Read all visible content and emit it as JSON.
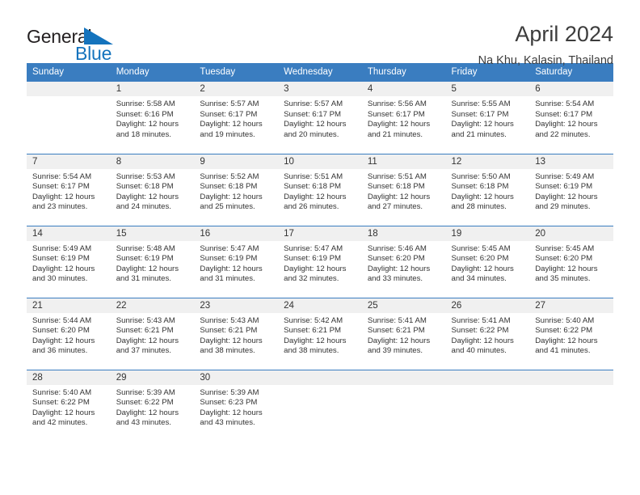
{
  "brand": {
    "word_one": "General",
    "word_two": "Blue",
    "flag_icon": "triangle-flag-icon",
    "accent_color": "#1473bd"
  },
  "header": {
    "title": "April 2024",
    "subtitle": "Na Khu, Kalasin, Thailand"
  },
  "theme": {
    "header_blue": "#3a7dc0",
    "band_gray": "#f0f0f0",
    "text": "#333333"
  },
  "calendar": {
    "weekday_headers": [
      "Sunday",
      "Monday",
      "Tuesday",
      "Wednesday",
      "Thursday",
      "Friday",
      "Saturday"
    ],
    "weeks": [
      [
        {
          "day": "",
          "sunrise": "",
          "sunset": "",
          "daylight_line1": "",
          "daylight_line2": ""
        },
        {
          "day": "1",
          "sunrise": "Sunrise: 5:58 AM",
          "sunset": "Sunset: 6:16 PM",
          "daylight_line1": "Daylight: 12 hours",
          "daylight_line2": "and 18 minutes."
        },
        {
          "day": "2",
          "sunrise": "Sunrise: 5:57 AM",
          "sunset": "Sunset: 6:17 PM",
          "daylight_line1": "Daylight: 12 hours",
          "daylight_line2": "and 19 minutes."
        },
        {
          "day": "3",
          "sunrise": "Sunrise: 5:57 AM",
          "sunset": "Sunset: 6:17 PM",
          "daylight_line1": "Daylight: 12 hours",
          "daylight_line2": "and 20 minutes."
        },
        {
          "day": "4",
          "sunrise": "Sunrise: 5:56 AM",
          "sunset": "Sunset: 6:17 PM",
          "daylight_line1": "Daylight: 12 hours",
          "daylight_line2": "and 21 minutes."
        },
        {
          "day": "5",
          "sunrise": "Sunrise: 5:55 AM",
          "sunset": "Sunset: 6:17 PM",
          "daylight_line1": "Daylight: 12 hours",
          "daylight_line2": "and 21 minutes."
        },
        {
          "day": "6",
          "sunrise": "Sunrise: 5:54 AM",
          "sunset": "Sunset: 6:17 PM",
          "daylight_line1": "Daylight: 12 hours",
          "daylight_line2": "and 22 minutes."
        }
      ],
      [
        {
          "day": "7",
          "sunrise": "Sunrise: 5:54 AM",
          "sunset": "Sunset: 6:17 PM",
          "daylight_line1": "Daylight: 12 hours",
          "daylight_line2": "and 23 minutes."
        },
        {
          "day": "8",
          "sunrise": "Sunrise: 5:53 AM",
          "sunset": "Sunset: 6:18 PM",
          "daylight_line1": "Daylight: 12 hours",
          "daylight_line2": "and 24 minutes."
        },
        {
          "day": "9",
          "sunrise": "Sunrise: 5:52 AM",
          "sunset": "Sunset: 6:18 PM",
          "daylight_line1": "Daylight: 12 hours",
          "daylight_line2": "and 25 minutes."
        },
        {
          "day": "10",
          "sunrise": "Sunrise: 5:51 AM",
          "sunset": "Sunset: 6:18 PM",
          "daylight_line1": "Daylight: 12 hours",
          "daylight_line2": "and 26 minutes."
        },
        {
          "day": "11",
          "sunrise": "Sunrise: 5:51 AM",
          "sunset": "Sunset: 6:18 PM",
          "daylight_line1": "Daylight: 12 hours",
          "daylight_line2": "and 27 minutes."
        },
        {
          "day": "12",
          "sunrise": "Sunrise: 5:50 AM",
          "sunset": "Sunset: 6:18 PM",
          "daylight_line1": "Daylight: 12 hours",
          "daylight_line2": "and 28 minutes."
        },
        {
          "day": "13",
          "sunrise": "Sunrise: 5:49 AM",
          "sunset": "Sunset: 6:19 PM",
          "daylight_line1": "Daylight: 12 hours",
          "daylight_line2": "and 29 minutes."
        }
      ],
      [
        {
          "day": "14",
          "sunrise": "Sunrise: 5:49 AM",
          "sunset": "Sunset: 6:19 PM",
          "daylight_line1": "Daylight: 12 hours",
          "daylight_line2": "and 30 minutes."
        },
        {
          "day": "15",
          "sunrise": "Sunrise: 5:48 AM",
          "sunset": "Sunset: 6:19 PM",
          "daylight_line1": "Daylight: 12 hours",
          "daylight_line2": "and 31 minutes."
        },
        {
          "day": "16",
          "sunrise": "Sunrise: 5:47 AM",
          "sunset": "Sunset: 6:19 PM",
          "daylight_line1": "Daylight: 12 hours",
          "daylight_line2": "and 31 minutes."
        },
        {
          "day": "17",
          "sunrise": "Sunrise: 5:47 AM",
          "sunset": "Sunset: 6:19 PM",
          "daylight_line1": "Daylight: 12 hours",
          "daylight_line2": "and 32 minutes."
        },
        {
          "day": "18",
          "sunrise": "Sunrise: 5:46 AM",
          "sunset": "Sunset: 6:20 PM",
          "daylight_line1": "Daylight: 12 hours",
          "daylight_line2": "and 33 minutes."
        },
        {
          "day": "19",
          "sunrise": "Sunrise: 5:45 AM",
          "sunset": "Sunset: 6:20 PM",
          "daylight_line1": "Daylight: 12 hours",
          "daylight_line2": "and 34 minutes."
        },
        {
          "day": "20",
          "sunrise": "Sunrise: 5:45 AM",
          "sunset": "Sunset: 6:20 PM",
          "daylight_line1": "Daylight: 12 hours",
          "daylight_line2": "and 35 minutes."
        }
      ],
      [
        {
          "day": "21",
          "sunrise": "Sunrise: 5:44 AM",
          "sunset": "Sunset: 6:20 PM",
          "daylight_line1": "Daylight: 12 hours",
          "daylight_line2": "and 36 minutes."
        },
        {
          "day": "22",
          "sunrise": "Sunrise: 5:43 AM",
          "sunset": "Sunset: 6:21 PM",
          "daylight_line1": "Daylight: 12 hours",
          "daylight_line2": "and 37 minutes."
        },
        {
          "day": "23",
          "sunrise": "Sunrise: 5:43 AM",
          "sunset": "Sunset: 6:21 PM",
          "daylight_line1": "Daylight: 12 hours",
          "daylight_line2": "and 38 minutes."
        },
        {
          "day": "24",
          "sunrise": "Sunrise: 5:42 AM",
          "sunset": "Sunset: 6:21 PM",
          "daylight_line1": "Daylight: 12 hours",
          "daylight_line2": "and 38 minutes."
        },
        {
          "day": "25",
          "sunrise": "Sunrise: 5:41 AM",
          "sunset": "Sunset: 6:21 PM",
          "daylight_line1": "Daylight: 12 hours",
          "daylight_line2": "and 39 minutes."
        },
        {
          "day": "26",
          "sunrise": "Sunrise: 5:41 AM",
          "sunset": "Sunset: 6:22 PM",
          "daylight_line1": "Daylight: 12 hours",
          "daylight_line2": "and 40 minutes."
        },
        {
          "day": "27",
          "sunrise": "Sunrise: 5:40 AM",
          "sunset": "Sunset: 6:22 PM",
          "daylight_line1": "Daylight: 12 hours",
          "daylight_line2": "and 41 minutes."
        }
      ],
      [
        {
          "day": "28",
          "sunrise": "Sunrise: 5:40 AM",
          "sunset": "Sunset: 6:22 PM",
          "daylight_line1": "Daylight: 12 hours",
          "daylight_line2": "and 42 minutes."
        },
        {
          "day": "29",
          "sunrise": "Sunrise: 5:39 AM",
          "sunset": "Sunset: 6:22 PM",
          "daylight_line1": "Daylight: 12 hours",
          "daylight_line2": "and 43 minutes."
        },
        {
          "day": "30",
          "sunrise": "Sunrise: 5:39 AM",
          "sunset": "Sunset: 6:23 PM",
          "daylight_line1": "Daylight: 12 hours",
          "daylight_line2": "and 43 minutes."
        },
        {
          "day": "",
          "sunrise": "",
          "sunset": "",
          "daylight_line1": "",
          "daylight_line2": ""
        },
        {
          "day": "",
          "sunrise": "",
          "sunset": "",
          "daylight_line1": "",
          "daylight_line2": ""
        },
        {
          "day": "",
          "sunrise": "",
          "sunset": "",
          "daylight_line1": "",
          "daylight_line2": ""
        },
        {
          "day": "",
          "sunrise": "",
          "sunset": "",
          "daylight_line1": "",
          "daylight_line2": ""
        }
      ]
    ]
  }
}
